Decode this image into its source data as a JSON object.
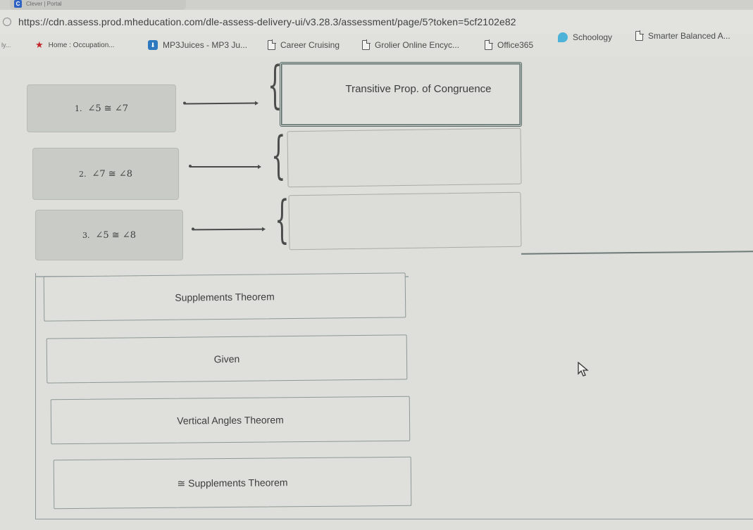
{
  "browser": {
    "tab": {
      "title": "Clever | Portal",
      "favicon": "C"
    },
    "url": "https://cdn.assess.prod.mheducation.com/dle-assess-delivery-ui/v3.28.3/assessment/page/5?token=5cf2102e82",
    "bookmarks": [
      {
        "label": "ly...",
        "icon": "none"
      },
      {
        "label": "Home : Occupation...",
        "icon": "star-icon"
      },
      {
        "label": "MP3Juices - MP3 Ju...",
        "icon": "download-icon"
      },
      {
        "label": "Career Cruising",
        "icon": "page-icon"
      },
      {
        "label": "Grolier Online Encyc...",
        "icon": "page-icon"
      },
      {
        "label": "Office365",
        "icon": "page-icon"
      },
      {
        "label": "Schoology",
        "icon": "schoology-icon"
      },
      {
        "label": "Smarter Balanced A...",
        "icon": "page-icon"
      }
    ]
  },
  "proof": {
    "statements": [
      {
        "number": "1.",
        "text": "∠5 ≅ ∠7"
      },
      {
        "number": "2.",
        "text": "∠7 ≅ ∠8"
      },
      {
        "number": "3.",
        "text": "∠5 ≅ ∠8"
      }
    ],
    "reasons": [
      {
        "value": "Transitive Prop. of Congruence",
        "filled": true
      },
      {
        "value": "",
        "filled": false
      },
      {
        "value": "",
        "filled": false
      }
    ]
  },
  "answer_bank": {
    "options": [
      "Supplements Theorem",
      "Given",
      "Vertical Angles Theorem",
      "≅ Supplements Theorem"
    ]
  },
  "colors": {
    "statement_bg": "#c9cbc6",
    "page_bg": "#dedfda",
    "filled_border": "#4e6260"
  }
}
